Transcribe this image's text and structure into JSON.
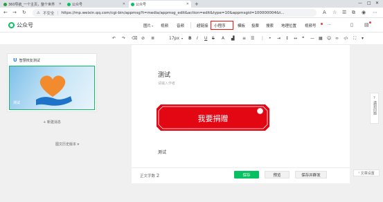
{
  "browser": {
    "tabs": [
      {
        "label": "360导航_一个主页，整个世界",
        "color": "#2e9e3f"
      },
      {
        "label": "公众号",
        "color": "#07c160"
      },
      {
        "label": "公众号",
        "color": "#07c160"
      }
    ],
    "security_label": "不安全",
    "url": "https://mp.weixin.qq.com/cgi-bin/appmsg?t=media/appmsg_edit&action=edit&type=10&appmsgid=100000004&t..."
  },
  "header": {
    "brand": "公众号",
    "menu": [
      {
        "label": "图片",
        "dropdown": true
      },
      {
        "label": "视频",
        "dropdown": false
      },
      {
        "label": "音频",
        "dropdown": false
      },
      {
        "label": "超链接",
        "dropdown": false
      },
      {
        "label": "小程序",
        "dropdown": false
      },
      {
        "label": "模板",
        "dropdown": false
      },
      {
        "label": "投票",
        "dropdown": false
      },
      {
        "label": "搜索",
        "dropdown": false
      },
      {
        "label": "地理位置",
        "dropdown": false
      },
      {
        "label": "视频号",
        "dropdown": false
      },
      {
        "label": "···",
        "dropdown": false
      }
    ]
  },
  "toolbar": {
    "font_size": "17px"
  },
  "article_list": {
    "card_title": "智慧校友测试",
    "thumb_caption": "测试",
    "new_message": "新建消息",
    "history": "图文历史版本"
  },
  "editor": {
    "title": "测试",
    "author_placeholder": "请输入作者",
    "donate_button": "我要捐赠",
    "body_text": "测试"
  },
  "side": {
    "doc_label": "遇到问题",
    "settings": "文章设置"
  },
  "bottom": {
    "word_count_label": "正文字数",
    "word_count": "2",
    "save": "保存",
    "preview": "预览",
    "save_send": "保存并群发"
  },
  "colors": {
    "accent_green": "#07c160",
    "donate_red": "#e30613",
    "highlight_red": "#e11111"
  }
}
